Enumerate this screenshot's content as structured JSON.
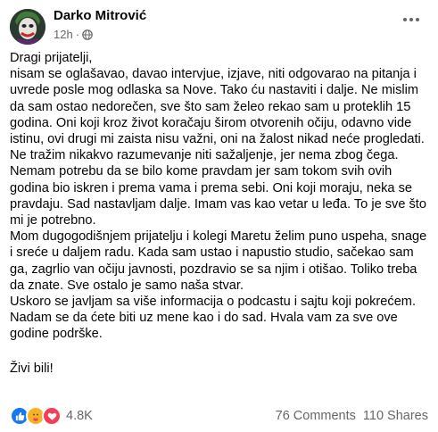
{
  "post": {
    "author": "Darko Mitrović",
    "time": "12h",
    "dot": "·",
    "paragraphs": [
      "Dragi prijatelji,",
      "nisam se oglašavao, davao intervjue, izjave, niti odgovarao na pitanja i uvrede posle mog odlaska sa Nove. Tako ću nastaviti i dalje. Ne mislim da sam ostao nedorečen, sve što sam želeo rekao sam u proteklih 15 godina. Oni koji kroz život koračaju širom otvorenih očiju, odavno vide istinu, ovi drugi mi zaista nisu važni, oni na žalost nikad neće progledati.",
      "Ne tražim nikakvo razumevanje niti sažaljenje, jer nema zbog čega. Nemam potrebu da se bilo kome pravdam jer sam tokom svih ovih godina bio iskren i prema vama i prema sebi. Oni koji moraju, neka se pravdaju. Sad nastavljam dalje. Imam vas kao vetar u leđa. To je sve što mi je potrebno.",
      "Mom dugogodišnjem prijatelju i kolegi Maretu želim puno uspeha, snage i sreće u daljem radu. Kada sam ustao i napustio studio, sačekao sam ga, zagrlio van očiju javnosti, pozdravio se sa njim i otišao. Toliko treba da znate. Sve ostalo je samo naša stvar.",
      "Uskoro se javljam sa više informacija o podcastu i sajtu koji pokrećem. Nadam se da ćete biti uz mene kao i do sad. Hvala vam za sve ove godine podrške."
    ],
    "signoff": "Živi bili!"
  },
  "footer": {
    "reaction_count": "4.8K",
    "comments": "76 Comments",
    "shares": "110 Shares"
  },
  "colors": {
    "like": "#1877f2",
    "care": "#f7b125",
    "love": "#f33e58",
    "meta": "#65676b"
  },
  "icons": [
    "avatar-joker",
    "globe-icon",
    "more-options-icon",
    "like-reaction-icon",
    "care-reaction-icon",
    "love-reaction-icon"
  ]
}
